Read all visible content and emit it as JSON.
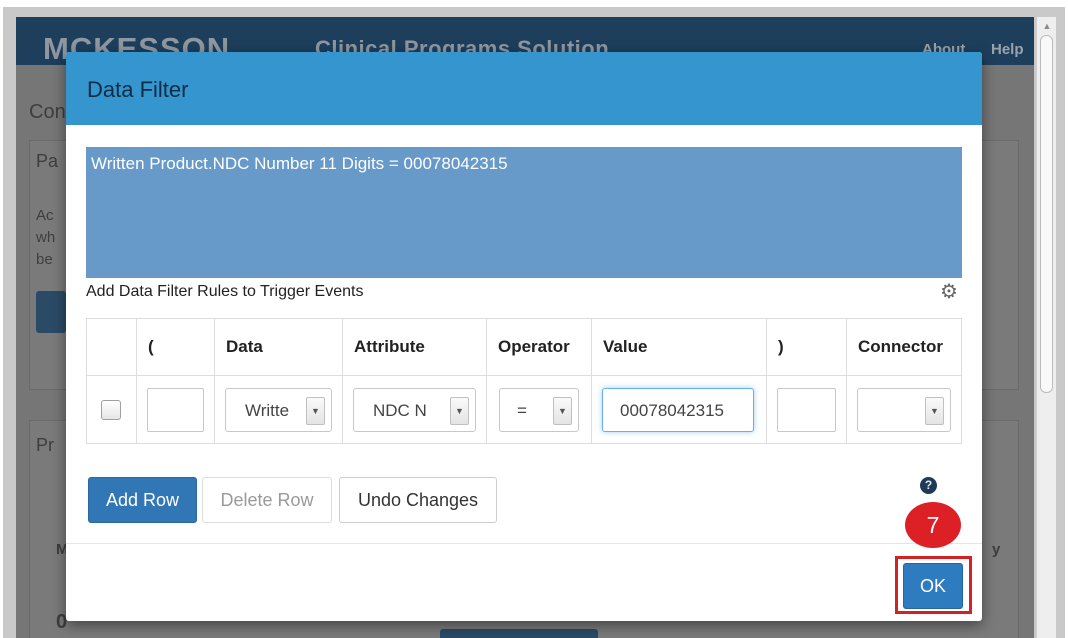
{
  "app": {
    "logo": "MCKESSON",
    "title": "Clinical Programs Solution",
    "nav": {
      "about": "About",
      "help": "Help"
    }
  },
  "background_fragments": {
    "page_heading": "Con",
    "panel_1_heading": "Pa",
    "panel_1_line_1": "Ac",
    "panel_1_line_2": "wh",
    "panel_1_line_3": "be",
    "panel_2_heading": "Pr",
    "panel_2_row_1": "M",
    "panel_2_row_2": "0",
    "panel_2_row_3": "y"
  },
  "dialog": {
    "title": "Data Filter",
    "filter_expression": "Written Product.NDC Number 11 Digits = 00078042315",
    "rules_label": "Add Data Filter Rules to Trigger Events",
    "gear_icon": "gear-icon",
    "columns": [
      "(",
      "Data",
      "Attribute",
      "Operator",
      "Value",
      ")",
      "Connector"
    ],
    "rows": [
      {
        "checked": false,
        "open_paren": "",
        "data": "Writte",
        "attribute": "NDC N",
        "operator": "=",
        "value": "00078042315",
        "close_paren": "",
        "connector": ""
      }
    ],
    "buttons": {
      "add_row": "Add Row",
      "delete_row": "Delete Row",
      "undo_changes": "Undo Changes",
      "ok": "OK"
    }
  },
  "annotation": {
    "step_number": "7",
    "highlight_color": "#d32224"
  },
  "colors": {
    "header_navy": "#1d3f5c",
    "dialog_header": "#3596cf",
    "filter_box": "#6799c9",
    "primary_button": "#3177b5"
  }
}
